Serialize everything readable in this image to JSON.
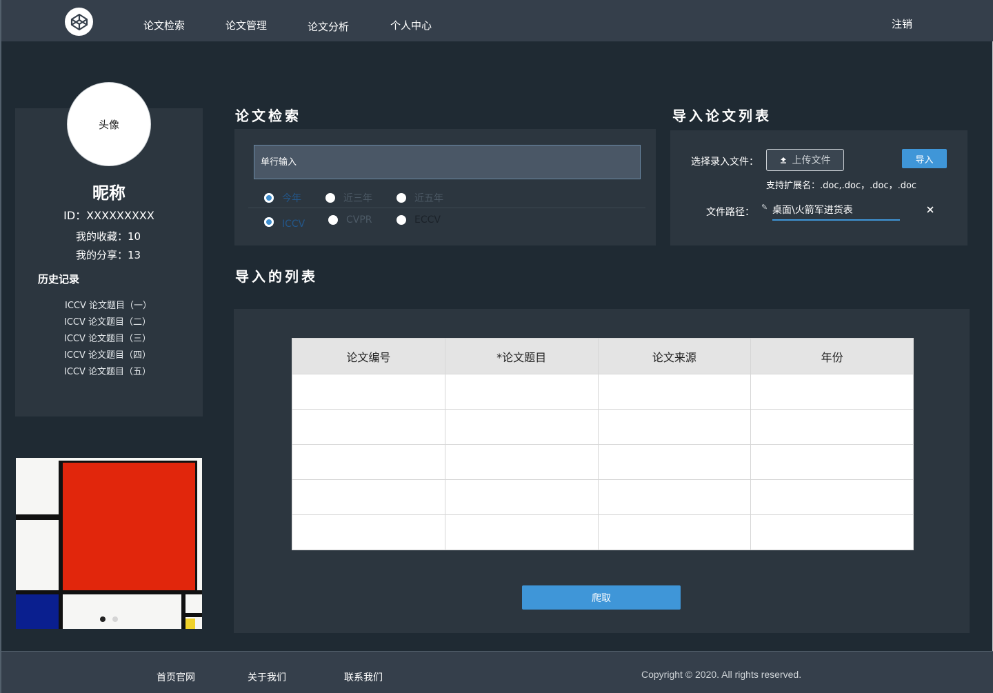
{
  "nav": {
    "items": [
      "论文检索",
      "论文管理",
      "论文分析",
      "个人中心"
    ],
    "logout": "注销"
  },
  "profile": {
    "avatar_label": "头像",
    "nickname": "昵称",
    "id": "ID：XXXXXXXXX",
    "favorites": "我的收藏：10",
    "shares": "我的分享：13",
    "history_title": "历史记录",
    "history": [
      "ICCV 论文题目（一）",
      "ICCV 论文题目（二）",
      "ICCV 论文题目（三）",
      "ICCV 论文题目（四）",
      "ICCV 论文题目（五）"
    ]
  },
  "carousel": {
    "slide_count": 2,
    "active_slide": 1
  },
  "search": {
    "title": "论文检索",
    "placeholder": "单行输入",
    "year_options": [
      "今年",
      "近三年",
      "近五年"
    ],
    "year_selected": "今年",
    "venue_options": [
      "ICCV",
      "CVPR",
      "ECCV"
    ],
    "venue_selected": "ICCV"
  },
  "import": {
    "title": "导入论文列表",
    "choose_label": "选择录入文件：",
    "upload_label": "上传文件",
    "import_button": "导入",
    "ext_hint": "支持扩展名：.doc,.doc，.doc，.doc",
    "path_label": "文件路径：",
    "path_value": "桌面\\火箭军进货表"
  },
  "list": {
    "title": "导入的列表",
    "columns": [
      "论文编号",
      "*论文题目",
      "论文来源",
      "年份"
    ],
    "rows": [
      [
        "",
        "",
        "",
        ""
      ],
      [
        "",
        "",
        "",
        ""
      ],
      [
        "",
        "",
        "",
        ""
      ],
      [
        "",
        "",
        "",
        ""
      ],
      [
        "",
        "",
        "",
        ""
      ]
    ],
    "crawl_button": "爬取"
  },
  "footer": {
    "links": [
      "首页官网",
      "关于我们",
      "联系我们"
    ],
    "copyright": "Copyright © 2020. All rights reserved."
  },
  "colors": {
    "accent": "#3f96d8",
    "panel": "#2c363f",
    "background": "#1f2a33",
    "header": "#353f4b"
  }
}
